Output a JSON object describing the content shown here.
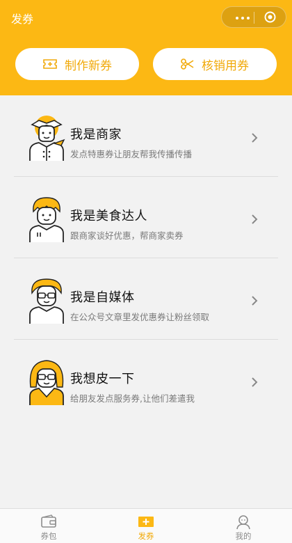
{
  "nav": {
    "title": "发券"
  },
  "actions": {
    "create_label": "制作新券",
    "redeem_label": "核销用券"
  },
  "items": [
    {
      "title": "我是商家",
      "desc": "发点特惠券让朋友帮我传播传播"
    },
    {
      "title": "我是美食达人",
      "desc": "跟商家谈好优惠，帮商家卖券"
    },
    {
      "title": "我是自媒体",
      "desc": "在公众号文章里发优惠券让粉丝领取"
    },
    {
      "title": "我想皮一下",
      "desc": "给朋友发点服务券,让他们差遣我"
    }
  ],
  "tabs": [
    {
      "label": "券包"
    },
    {
      "label": "发券"
    },
    {
      "label": "我的"
    }
  ],
  "colors": {
    "accent": "#fcb814",
    "accent_text": "#f1a908",
    "background": "#f2f2f2"
  }
}
